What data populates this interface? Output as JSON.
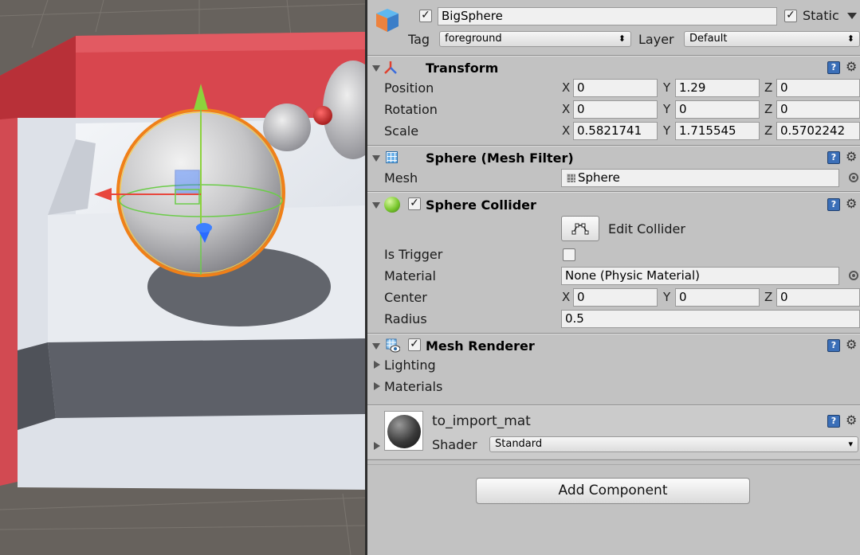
{
  "object": {
    "name": "BigSphere",
    "active": true,
    "static_label": "Static",
    "static_checked": true,
    "tag_label": "Tag",
    "tag_value": "foreground",
    "layer_label": "Layer",
    "layer_value": "Default"
  },
  "transform": {
    "title": "Transform",
    "position": {
      "label": "Position",
      "x": "0",
      "y": "1.29",
      "z": "0"
    },
    "rotation": {
      "label": "Rotation",
      "x": "0",
      "y": "0",
      "z": "0"
    },
    "scale": {
      "label": "Scale",
      "x": "0.5821741",
      "y": "1.715545",
      "z": "0.5702242"
    }
  },
  "axes": {
    "x": "X",
    "y": "Y",
    "z": "Z"
  },
  "mesh_filter": {
    "title": "Sphere (Mesh Filter)",
    "mesh_label": "Mesh",
    "mesh_value": "Sphere"
  },
  "sphere_collider": {
    "title": "Sphere Collider",
    "enabled": true,
    "edit_collider_label": "Edit Collider",
    "is_trigger_label": "Is Trigger",
    "is_trigger": false,
    "material_label": "Material",
    "material_value": "None (Physic Material)",
    "center_label": "Center",
    "center": {
      "x": "0",
      "y": "0",
      "z": "0"
    },
    "radius_label": "Radius",
    "radius_value": "0.5"
  },
  "mesh_renderer": {
    "title": "Mesh Renderer",
    "enabled": true,
    "lighting_label": "Lighting",
    "materials_label": "Materials"
  },
  "material": {
    "name": "to_import_mat",
    "shader_label": "Shader",
    "shader_value": "Standard"
  },
  "add_component_label": "Add Component",
  "icons": {
    "gameobject": "cube-icon",
    "transform": "transform-axes-icon",
    "mesh_filter": "mesh-grid-icon",
    "collider": "green-sphere-icon",
    "renderer": "renderer-icon",
    "help": "help-book-icon",
    "gear": "gear-icon"
  },
  "colors": {
    "inspector_bg": "#c2c2c2",
    "scene_wall": "#d84850",
    "scene_floor": "#dfe3ea",
    "selection_outline": "#f07a10",
    "gizmo_y": "#8cd23c",
    "gizmo_x": "#e8463c",
    "gizmo_z": "#2a6cff"
  }
}
